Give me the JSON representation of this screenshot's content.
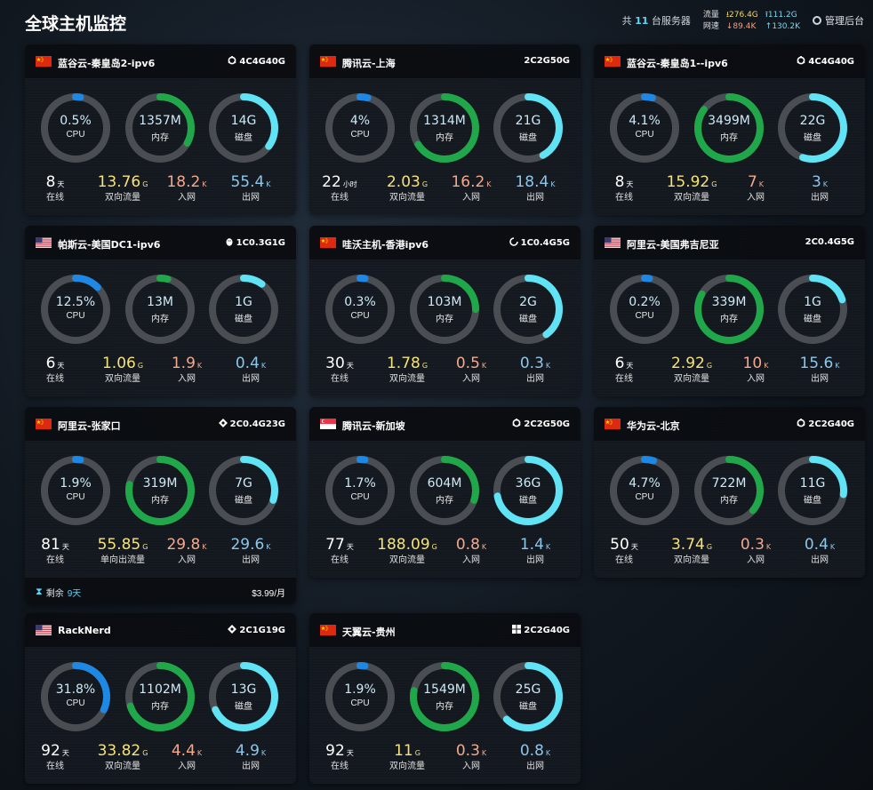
{
  "header": {
    "title": "全球主机监控",
    "servers_prefix": "共",
    "servers_count": "11",
    "servers_suffix": "台服务器",
    "traffic_label": "流量",
    "traffic_down": "⭳276.4G",
    "traffic_up": "⭱111.2G",
    "net_label": "网速",
    "net_in": "↓89.4K",
    "net_out": "↑130.2K",
    "admin_label": "管理后台"
  },
  "labels": {
    "cpu": "CPU",
    "mem": "内存",
    "disk": "磁盘",
    "online": "在线",
    "in": "入网",
    "out": "出网"
  },
  "colors": {
    "cpu": "#1e88e5",
    "mem": "#1fa74a",
    "disk": "#5fe3f5",
    "ring_track": "#4a4d52"
  },
  "servers": [
    {
      "flag": "cn",
      "name": "蓝谷云-秦皇岛2-ipv6",
      "spec_icon": "ubuntu-icon",
      "spec": "4C4G40G",
      "cpu": {
        "label": "0.5%",
        "pct": 0.5
      },
      "mem": {
        "label": "1357M",
        "pct": 33
      },
      "disk": {
        "label": "14G",
        "pct": 35
      },
      "online": {
        "value": "8",
        "unit": "天"
      },
      "traffic": {
        "value": "13.76",
        "unit": "G",
        "label": "双向流量"
      },
      "in": {
        "value": "18.2",
        "unit": "K"
      },
      "out": {
        "value": "55.4",
        "unit": "K"
      }
    },
    {
      "flag": "cn",
      "name": "腾讯云-上海",
      "spec_icon": "",
      "spec": "2C2G50G",
      "cpu": {
        "label": "4%",
        "pct": 4
      },
      "mem": {
        "label": "1314M",
        "pct": 66
      },
      "disk": {
        "label": "21G",
        "pct": 42
      },
      "online": {
        "value": "22",
        "unit": "小时"
      },
      "traffic": {
        "value": "2.03",
        "unit": "G",
        "label": "双向流量"
      },
      "in": {
        "value": "16.2",
        "unit": "K"
      },
      "out": {
        "value": "18.4",
        "unit": "K"
      }
    },
    {
      "flag": "cn",
      "name": "蓝谷云-秦皇岛1--ipv6",
      "spec_icon": "ubuntu-icon",
      "spec": "4C4G40G",
      "cpu": {
        "label": "4.1%",
        "pct": 4.1
      },
      "mem": {
        "label": "3499M",
        "pct": 85
      },
      "disk": {
        "label": "22G",
        "pct": 55
      },
      "online": {
        "value": "8",
        "unit": "天"
      },
      "traffic": {
        "value": "15.92",
        "unit": "G",
        "label": "双向流量"
      },
      "in": {
        "value": "7",
        "unit": "K"
      },
      "out": {
        "value": "3",
        "unit": "K"
      }
    },
    {
      "flag": "us",
      "name": "帕斯云-美国DC1-ipv6",
      "spec_icon": "linux-icon",
      "spec": "1C0.3G1G",
      "cpu": {
        "label": "12.5%",
        "pct": 12.5
      },
      "mem": {
        "label": "13M",
        "pct": 4
      },
      "disk": {
        "label": "1G",
        "pct": 10
      },
      "online": {
        "value": "6",
        "unit": "天"
      },
      "traffic": {
        "value": "1.06",
        "unit": "G",
        "label": "双向流量"
      },
      "in": {
        "value": "1.9",
        "unit": "K"
      },
      "out": {
        "value": "0.4",
        "unit": "K"
      }
    },
    {
      "flag": "cn",
      "name": "哇沃主机-香港ipv6",
      "spec_icon": "debian-icon",
      "spec": "1C0.4G5G",
      "cpu": {
        "label": "0.3%",
        "pct": 0.3
      },
      "mem": {
        "label": "103M",
        "pct": 25
      },
      "disk": {
        "label": "2G",
        "pct": 40
      },
      "online": {
        "value": "30",
        "unit": "天"
      },
      "traffic": {
        "value": "1.78",
        "unit": "G",
        "label": "双向流量"
      },
      "in": {
        "value": "0.5",
        "unit": "K"
      },
      "out": {
        "value": "0.3",
        "unit": "K"
      }
    },
    {
      "flag": "us",
      "name": "阿里云-美国弗吉尼亚",
      "spec_icon": "",
      "spec": "2C0.4G5G",
      "cpu": {
        "label": "0.2%",
        "pct": 0.2
      },
      "mem": {
        "label": "339M",
        "pct": 83
      },
      "disk": {
        "label": "1G",
        "pct": 20
      },
      "online": {
        "value": "6",
        "unit": "天"
      },
      "traffic": {
        "value": "2.92",
        "unit": "G",
        "label": "双向流量"
      },
      "in": {
        "value": "10",
        "unit": "K"
      },
      "out": {
        "value": "15.6",
        "unit": "K"
      }
    },
    {
      "flag": "cn",
      "name": "阿里云-张家口",
      "spec_icon": "centos-icon",
      "spec": "2C0.4G23G",
      "cpu": {
        "label": "1.9%",
        "pct": 1.9
      },
      "mem": {
        "label": "319M",
        "pct": 78
      },
      "disk": {
        "label": "7G",
        "pct": 30
      },
      "online": {
        "value": "81",
        "unit": "天"
      },
      "traffic": {
        "value": "55.85",
        "unit": "G",
        "label": "单向出流量"
      },
      "in": {
        "value": "29.8",
        "unit": "K"
      },
      "out": {
        "value": "29.6",
        "unit": "K"
      },
      "footer": {
        "prefix": "剩余",
        "days": "9天",
        "price": "$3.99/月"
      }
    },
    {
      "flag": "sg",
      "name": "腾讯云-新加坡",
      "spec_icon": "ubuntu-icon",
      "spec": "2C2G50G",
      "cpu": {
        "label": "1.7%",
        "pct": 1.7
      },
      "mem": {
        "label": "604M",
        "pct": 30
      },
      "disk": {
        "label": "36G",
        "pct": 72
      },
      "online": {
        "value": "77",
        "unit": "天"
      },
      "traffic": {
        "value": "188.09",
        "unit": "G",
        "label": "双向流量"
      },
      "in": {
        "value": "0.8",
        "unit": "K"
      },
      "out": {
        "value": "1.4",
        "unit": "K"
      }
    },
    {
      "flag": "cn",
      "name": "华为云-北京",
      "spec_icon": "ubuntu-icon",
      "spec": "2C2G40G",
      "cpu": {
        "label": "4.7%",
        "pct": 4.7
      },
      "mem": {
        "label": "722M",
        "pct": 36
      },
      "disk": {
        "label": "11G",
        "pct": 27
      },
      "online": {
        "value": "50",
        "unit": "天"
      },
      "traffic": {
        "value": "3.74",
        "unit": "G",
        "label": "双向流量"
      },
      "in": {
        "value": "0.3",
        "unit": "K"
      },
      "out": {
        "value": "0.4",
        "unit": "K"
      }
    },
    {
      "flag": "us",
      "name": "RackNerd",
      "spec_icon": "centos-icon",
      "spec": "2C1G19G",
      "cpu": {
        "label": "31.8%",
        "pct": 31.8
      },
      "mem": {
        "label": "1102M",
        "pct": 70
      },
      "disk": {
        "label": "13G",
        "pct": 68
      },
      "online": {
        "value": "92",
        "unit": "天"
      },
      "traffic": {
        "value": "33.82",
        "unit": "G",
        "label": "双向流量"
      },
      "in": {
        "value": "4.4",
        "unit": "K"
      },
      "out": {
        "value": "4.9",
        "unit": "K"
      }
    },
    {
      "flag": "cn",
      "name": "天翼云-贵州",
      "spec_icon": "windows-icon",
      "spec": "2C2G40G",
      "cpu": {
        "label": "1.9%",
        "pct": 1.9
      },
      "mem": {
        "label": "1549M",
        "pct": 78
      },
      "disk": {
        "label": "25G",
        "pct": 62
      },
      "online": {
        "value": "92",
        "unit": "天"
      },
      "traffic": {
        "value": "11",
        "unit": "G",
        "label": "双向流量"
      },
      "in": {
        "value": "0.3",
        "unit": "K"
      },
      "out": {
        "value": "0.8",
        "unit": "K"
      }
    }
  ]
}
